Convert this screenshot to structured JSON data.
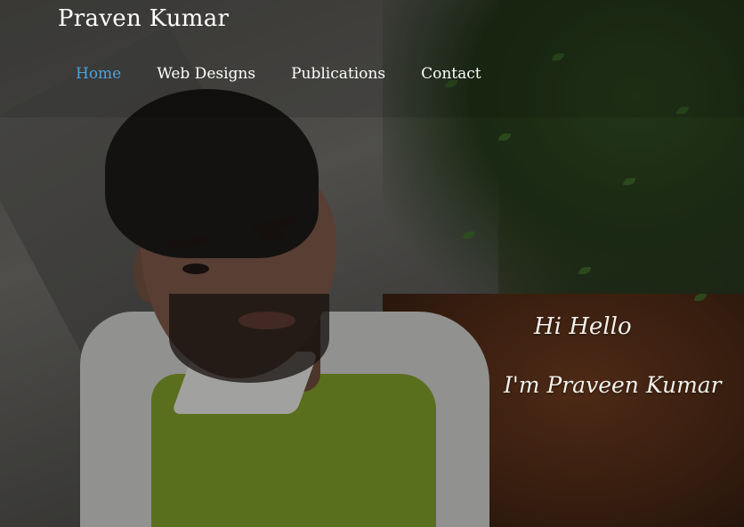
{
  "site": {
    "brand": "Praven Kumar"
  },
  "nav": {
    "items": [
      {
        "label": "Home",
        "active": true
      },
      {
        "label": "Web Designs",
        "active": false
      },
      {
        "label": "Publications",
        "active": false
      },
      {
        "label": "Contact",
        "active": false
      }
    ]
  },
  "hero": {
    "greeting_line1": "Hi Hello",
    "greeting_line2": "I'm Praveen Kumar"
  },
  "colors": {
    "active_nav": "#4aa3df",
    "text": "#ffffff"
  }
}
